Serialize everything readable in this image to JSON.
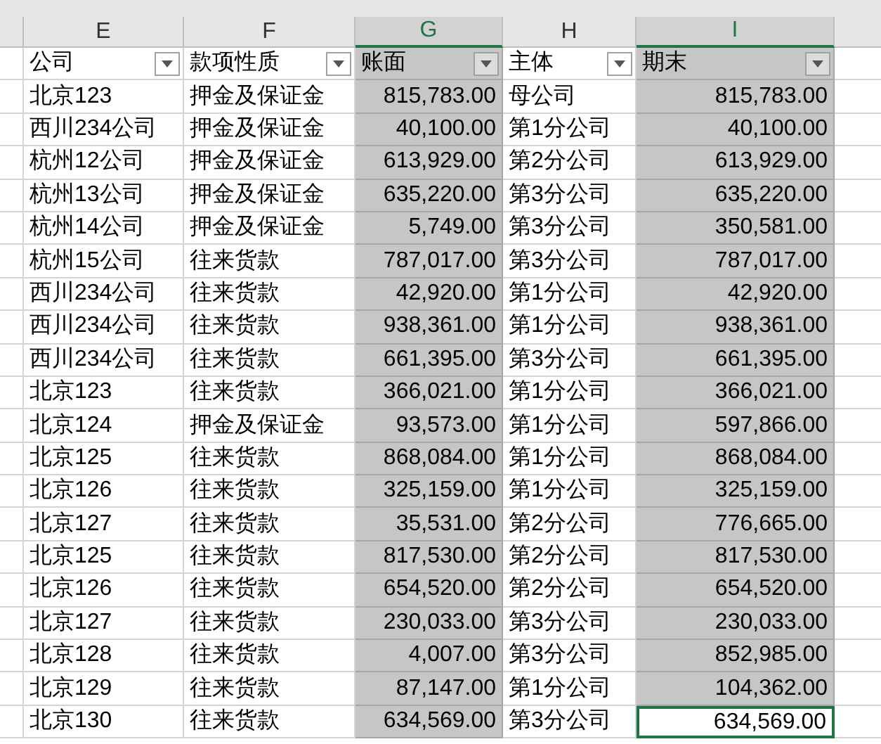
{
  "columns": [
    {
      "letter": "E",
      "selected": false,
      "kind": "text",
      "header": "公司"
    },
    {
      "letter": "F",
      "selected": false,
      "kind": "text",
      "header": "款项性质"
    },
    {
      "letter": "G",
      "selected": true,
      "kind": "number",
      "header": "账面"
    },
    {
      "letter": "H",
      "selected": false,
      "kind": "text",
      "header": "主体"
    },
    {
      "letter": "I",
      "selected": true,
      "kind": "number",
      "header": "期末"
    }
  ],
  "rows": [
    {
      "cells": [
        "北京123",
        "押金及保证金",
        "815,783.00",
        "母公司",
        "815,783.00"
      ],
      "active": false
    },
    {
      "cells": [
        "西川234公司",
        "押金及保证金",
        "40,100.00",
        "第1分公司",
        "40,100.00"
      ],
      "active": false
    },
    {
      "cells": [
        "杭州12公司",
        "押金及保证金",
        "613,929.00",
        "第2分公司",
        "613,929.00"
      ],
      "active": false
    },
    {
      "cells": [
        "杭州13公司",
        "押金及保证金",
        "635,220.00",
        "第3分公司",
        "635,220.00"
      ],
      "active": false
    },
    {
      "cells": [
        "杭州14公司",
        "押金及保证金",
        "5,749.00",
        "第3分公司",
        "350,581.00"
      ],
      "active": false
    },
    {
      "cells": [
        "杭州15公司",
        "往来货款",
        "787,017.00",
        "第3分公司",
        "787,017.00"
      ],
      "active": false
    },
    {
      "cells": [
        "西川234公司",
        "往来货款",
        "42,920.00",
        "第1分公司",
        "42,920.00"
      ],
      "active": false
    },
    {
      "cells": [
        "西川234公司",
        "往来货款",
        "938,361.00",
        "第1分公司",
        "938,361.00"
      ],
      "active": false
    },
    {
      "cells": [
        "西川234公司",
        "往来货款",
        "661,395.00",
        "第3分公司",
        "661,395.00"
      ],
      "active": false
    },
    {
      "cells": [
        "北京123",
        "往来货款",
        "366,021.00",
        "第1分公司",
        "366,021.00"
      ],
      "active": false
    },
    {
      "cells": [
        "北京124",
        "押金及保证金",
        "93,573.00",
        "第1分公司",
        "597,866.00"
      ],
      "active": false
    },
    {
      "cells": [
        "北京125",
        "往来货款",
        "868,084.00",
        "第1分公司",
        "868,084.00"
      ],
      "active": false
    },
    {
      "cells": [
        "北京126",
        "往来货款",
        "325,159.00",
        "第1分公司",
        "325,159.00"
      ],
      "active": false
    },
    {
      "cells": [
        "北京127",
        "往来货款",
        "35,531.00",
        "第2分公司",
        "776,665.00"
      ],
      "active": false
    },
    {
      "cells": [
        "北京125",
        "往来货款",
        "817,530.00",
        "第2分公司",
        "817,530.00"
      ],
      "active": false
    },
    {
      "cells": [
        "北京126",
        "往来货款",
        "654,520.00",
        "第2分公司",
        "654,520.00"
      ],
      "active": false
    },
    {
      "cells": [
        "北京127",
        "往来货款",
        "230,033.00",
        "第3分公司",
        "230,033.00"
      ],
      "active": false
    },
    {
      "cells": [
        "北京128",
        "往来货款",
        "4,007.00",
        "第3分公司",
        "852,985.00"
      ],
      "active": false
    },
    {
      "cells": [
        "北京129",
        "往来货款",
        "87,147.00",
        "第1分公司",
        "104,362.00"
      ],
      "active": false
    },
    {
      "cells": [
        "北京130",
        "往来货款",
        "634,569.00",
        "第3分公司",
        "634,569.00"
      ],
      "active": true
    }
  ]
}
